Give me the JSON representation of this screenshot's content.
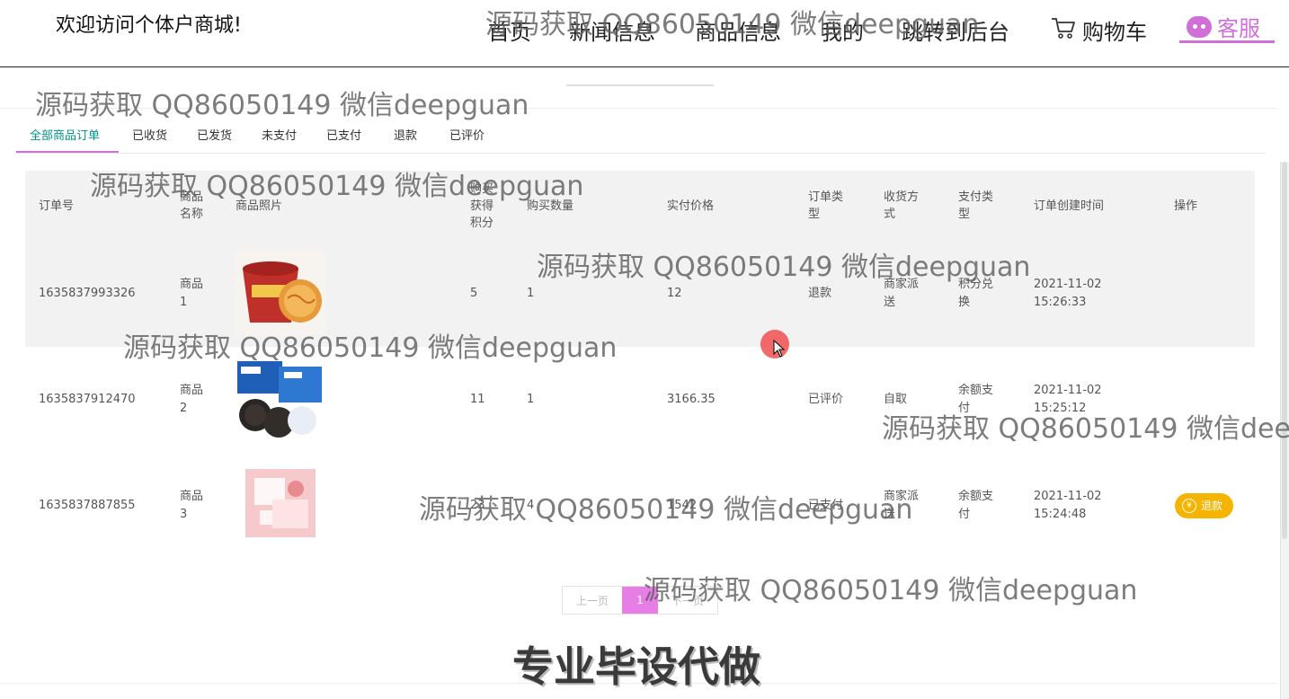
{
  "header": {
    "welcome": "欢迎访问个体户商城!",
    "nav": [
      "首页",
      "新闻信息",
      "商品信息",
      "我的",
      "跳转到后台"
    ],
    "cart": "购物车",
    "service": "客服"
  },
  "tabs": [
    "全部商品订单",
    "已收货",
    "已发货",
    "未支付",
    "已支付",
    "退款",
    "已评价"
  ],
  "table": {
    "headers": [
      "订单号",
      "商品名称",
      "商品照片",
      "购买获得积分",
      "购买数量",
      "实付价格",
      "订单类型",
      "收货方式",
      "支付类型",
      "订单创建时间",
      "操作"
    ],
    "rows": [
      {
        "order_no": "1635837993326",
        "name": "商品1",
        "photo": "instant-noodle-cup",
        "points": "5",
        "qty": "1",
        "price": "12",
        "type": "退款",
        "delivery": "商家派送",
        "pay": "积分兑换",
        "date": "2021-11-02",
        "time": "15:26:33",
        "action": ""
      },
      {
        "order_no": "1635837912470",
        "name": "商品2",
        "photo": "oreo-cookies",
        "points": "11",
        "qty": "1",
        "price": "3166.35",
        "type": "已评价",
        "delivery": "自取",
        "pay": "余额支付",
        "date": "2021-11-02",
        "time": "15:25:12",
        "action": ""
      },
      {
        "order_no": "1635837887855",
        "name": "商品3",
        "photo": "pink-snack-pack",
        "points": "23",
        "qty": "4",
        "price": "1542",
        "type": "已支付",
        "delivery": "商家派送",
        "pay": "余额支付",
        "date": "2021-11-02",
        "time": "15:24:48",
        "action": "退款"
      }
    ]
  },
  "pager": {
    "prev": "上一页",
    "current": "1",
    "next": "下一页"
  },
  "watermark": "源码获取 QQ86050149 微信deepguan",
  "promo": "专业毕设代做",
  "colors": {
    "accent": "#d16fd8",
    "tab_active": "#009688",
    "refund": "#f5b400"
  }
}
